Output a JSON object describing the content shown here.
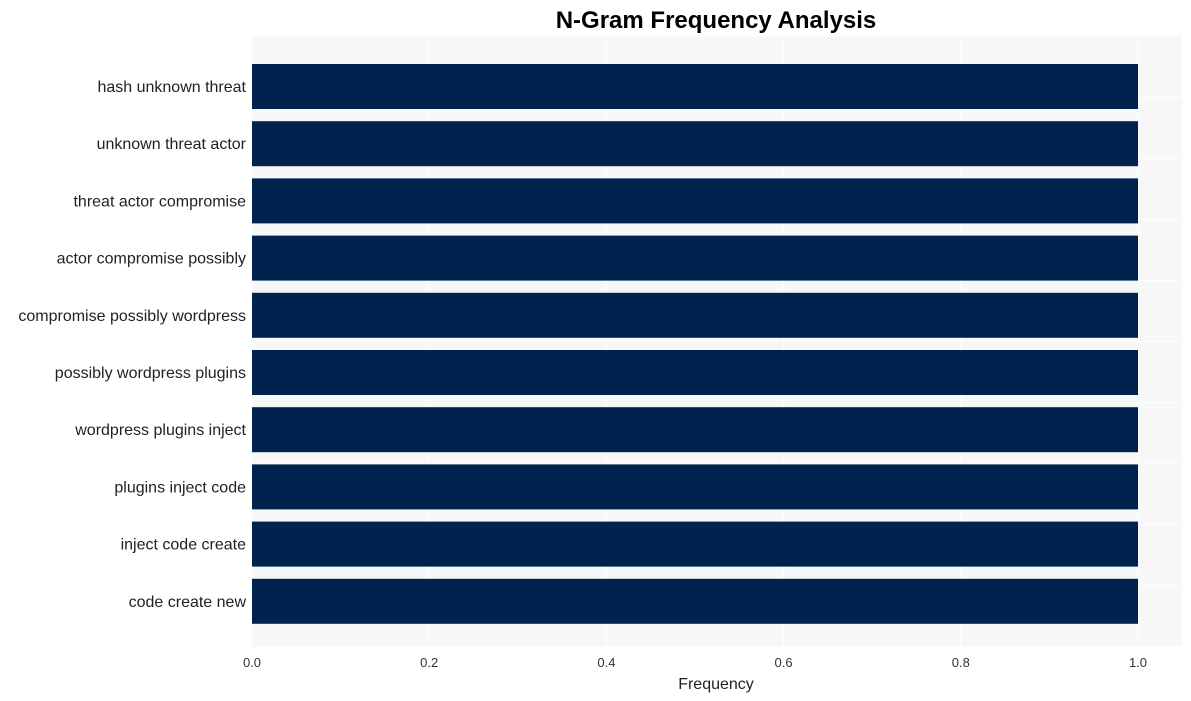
{
  "chart_data": {
    "type": "bar",
    "orientation": "horizontal",
    "title": "N-Gram Frequency Analysis",
    "xlabel": "Frequency",
    "ylabel": "",
    "categories": [
      "hash unknown threat",
      "unknown threat actor",
      "threat actor compromise",
      "actor compromise possibly",
      "compromise possibly wordpress",
      "possibly wordpress plugins",
      "wordpress plugins inject",
      "plugins inject code",
      "inject code create",
      "code create new"
    ],
    "values": [
      1.0,
      1.0,
      1.0,
      1.0,
      1.0,
      1.0,
      1.0,
      1.0,
      1.0,
      1.0
    ],
    "xlim": [
      0.0,
      1.05
    ],
    "xticks": [
      "0.0",
      "0.2",
      "0.4",
      "0.6",
      "0.8",
      "1.0"
    ],
    "grid": true,
    "legend": "none",
    "colors": {
      "bar": "#00224e",
      "plot_background": "#f7f7f7",
      "grid": "#ffffff"
    }
  }
}
